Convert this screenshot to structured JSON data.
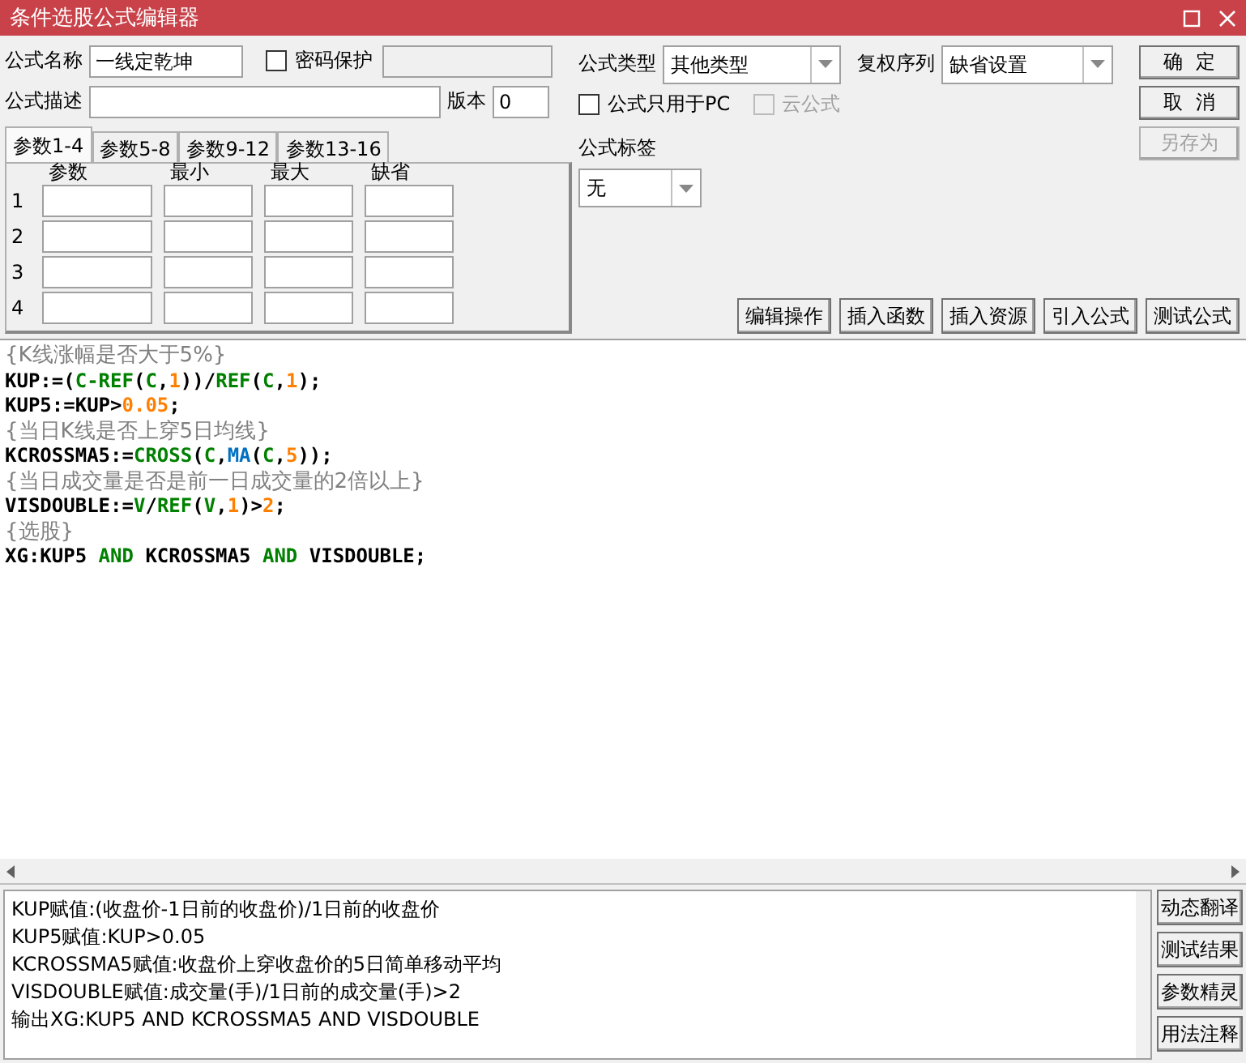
{
  "window": {
    "title": "条件选股公式编辑器"
  },
  "form": {
    "name_label": "公式名称",
    "name_value": "一线定乾坤",
    "password": {
      "label": "密码保护",
      "checked": false,
      "disabled": false
    },
    "desc_label": "公式描述",
    "version_label": "版本",
    "version_value": "0",
    "type_label": "公式类型",
    "type_value": "其他类型",
    "adjust_label": "复权序列",
    "adjust_value": "缺省设置",
    "options": [
      {
        "label": "公式只用于PC",
        "checked": false,
        "disabled": false
      },
      {
        "label": "云公式",
        "checked": false,
        "disabled": true
      }
    ],
    "tag_label": "公式标签",
    "tag_value": "无"
  },
  "side_buttons": [
    {
      "label": "确  定",
      "disabled": false
    },
    {
      "label": "取  消",
      "disabled": false
    },
    {
      "label": "另存为",
      "disabled": true
    }
  ],
  "tabs": [
    {
      "label": "参数1-4",
      "selected": true
    },
    {
      "label": "参数5-8",
      "selected": false
    },
    {
      "label": "参数9-12",
      "selected": false
    },
    {
      "label": "参数13-16",
      "selected": false
    }
  ],
  "params": {
    "columns": [
      "参数",
      "最小",
      "最大",
      "缺省"
    ],
    "rows": [
      "1",
      "2",
      "3",
      "4"
    ]
  },
  "action_buttons": [
    "编辑操作",
    "插入函数",
    "插入资源",
    "引入公式",
    "测试公式"
  ],
  "code": [
    {
      "kind": "comment",
      "text": "{K线涨幅是否大于5%}"
    },
    {
      "kind": "code",
      "tokens": [
        {
          "kind": "plain",
          "text": "KUP:=("
        },
        {
          "kind": "func",
          "text": "C-REF"
        },
        {
          "kind": "plain",
          "text": "("
        },
        {
          "kind": "func",
          "text": "C"
        },
        {
          "kind": "plain",
          "text": ","
        },
        {
          "kind": "num",
          "text": "1"
        },
        {
          "kind": "plain",
          "text": "))/"
        },
        {
          "kind": "func",
          "text": "REF"
        },
        {
          "kind": "plain",
          "text": "("
        },
        {
          "kind": "func",
          "text": "C"
        },
        {
          "kind": "plain",
          "text": ","
        },
        {
          "kind": "num",
          "text": "1"
        },
        {
          "kind": "plain",
          "text": ");"
        }
      ]
    },
    {
      "kind": "code",
      "tokens": [
        {
          "kind": "plain",
          "text": "KUP5:=KUP>"
        },
        {
          "kind": "num",
          "text": "0.05"
        },
        {
          "kind": "plain",
          "text": ";"
        }
      ]
    },
    {
      "kind": "comment",
      "text": "{当日K线是否上穿5日均线}"
    },
    {
      "kind": "code",
      "tokens": [
        {
          "kind": "plain",
          "text": "KCROSSMA5:="
        },
        {
          "kind": "func",
          "text": "CROSS"
        },
        {
          "kind": "plain",
          "text": "("
        },
        {
          "kind": "func",
          "text": "C"
        },
        {
          "kind": "plain",
          "text": ","
        },
        {
          "kind": "ind",
          "text": "MA"
        },
        {
          "kind": "plain",
          "text": "("
        },
        {
          "kind": "func",
          "text": "C"
        },
        {
          "kind": "plain",
          "text": ","
        },
        {
          "kind": "num",
          "text": "5"
        },
        {
          "kind": "plain",
          "text": "));"
        }
      ]
    },
    {
      "kind": "comment",
      "text": "{当日成交量是否是前一日成交量的2倍以上}"
    },
    {
      "kind": "code",
      "tokens": [
        {
          "kind": "plain",
          "text": "VISDOUBLE:="
        },
        {
          "kind": "func",
          "text": "V"
        },
        {
          "kind": "plain",
          "text": "/"
        },
        {
          "kind": "func",
          "text": "REF"
        },
        {
          "kind": "plain",
          "text": "("
        },
        {
          "kind": "func",
          "text": "V"
        },
        {
          "kind": "plain",
          "text": ","
        },
        {
          "kind": "num",
          "text": "1"
        },
        {
          "kind": "plain",
          "text": ")>"
        },
        {
          "kind": "num",
          "text": "2"
        },
        {
          "kind": "plain",
          "text": ";"
        }
      ]
    },
    {
      "kind": "comment",
      "text": "{选股}"
    },
    {
      "kind": "code",
      "tokens": [
        {
          "kind": "plain",
          "text": "XG:KUP5 "
        },
        {
          "kind": "func",
          "text": "AND"
        },
        {
          "kind": "plain",
          "text": " KCROSSMA5 "
        },
        {
          "kind": "func",
          "text": "AND"
        },
        {
          "kind": "plain",
          "text": " VISDOUBLE;"
        }
      ]
    }
  ],
  "translation": [
    "KUP赋值:(收盘价-1日前的收盘价)/1日前的收盘价",
    "KUP5赋值:KUP>0.05",
    "KCROSSMA5赋值:收盘价上穿收盘价的5日简单移动平均",
    "VISDOUBLE赋值:成交量(手)/1日前的成交量(手)>2",
    "输出XG:KUP5 AND KCROSSMA5 AND VISDOUBLE"
  ],
  "translation_buttons": [
    "动态翻译",
    "测试结果",
    "参数精灵",
    "用法注释"
  ]
}
